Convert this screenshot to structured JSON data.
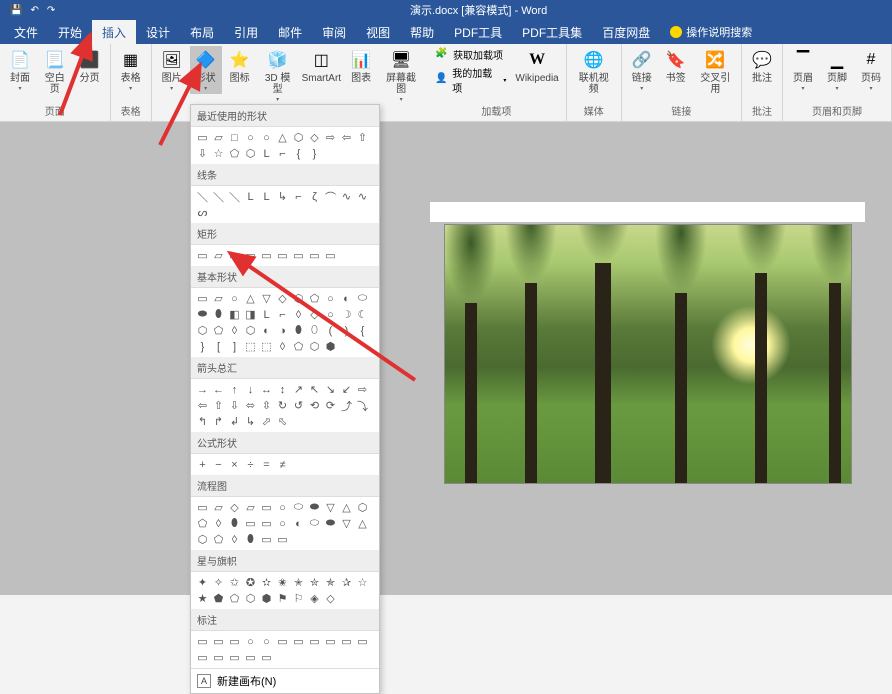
{
  "title": "演示.docx [兼容模式] - Word",
  "tabs": [
    "文件",
    "开始",
    "插入",
    "设计",
    "布局",
    "引用",
    "邮件",
    "审阅",
    "视图",
    "帮助",
    "PDF工具",
    "PDF工具集",
    "百度网盘"
  ],
  "active_tab": 2,
  "tellme": "操作说明搜索",
  "groups": {
    "pages": {
      "label": "页面",
      "items": [
        "封面",
        "空白页",
        "分页"
      ]
    },
    "tables": {
      "label": "表格",
      "items": [
        "表格"
      ]
    },
    "illust": {
      "label": "插图",
      "items": [
        "图片",
        "形状",
        "图标",
        "3D 模型",
        "SmartArt",
        "图表",
        "屏幕截图"
      ]
    },
    "addins": {
      "label": "加载项",
      "get": "获取加载项",
      "my": "我的加载项",
      "wiki": "Wikipedia"
    },
    "media": {
      "label": "媒体",
      "items": [
        "联机视频"
      ]
    },
    "links": {
      "label": "链接",
      "items": [
        "链接",
        "书签",
        "交叉引用"
      ]
    },
    "comments": {
      "label": "批注",
      "items": [
        "批注"
      ]
    },
    "headerfooter": {
      "label": "页眉和页脚",
      "items": [
        "页眉",
        "页脚",
        "页码"
      ]
    }
  },
  "shapes": {
    "sections": [
      {
        "name": "最近使用的形状",
        "shapes": [
          "▭",
          "▱",
          "□",
          "○",
          "○",
          "△",
          "⬡",
          "◇",
          "⇨",
          "⇦",
          "⇧",
          "⇩",
          "☆",
          "⬠",
          "⬡",
          "L",
          "⌐",
          "{",
          "}"
        ]
      },
      {
        "name": "线条",
        "shapes": [
          "＼",
          "＼",
          "＼",
          "L",
          "L",
          "↳",
          "⌐",
          "ζ",
          "⌒",
          "∿",
          "∿",
          "ᔕ"
        ]
      },
      {
        "name": "矩形",
        "shapes": [
          "▭",
          "▱",
          "▭",
          "▭",
          "▭",
          "▭",
          "▭",
          "▭",
          "▭"
        ]
      },
      {
        "name": "基本形状",
        "shapes": [
          "▭",
          "▱",
          "○",
          "△",
          "▽",
          "◇",
          "⬡",
          "⬠",
          "○",
          "◐",
          "⬭",
          "⬬",
          "⬮",
          "◧",
          "◨",
          "L",
          "⌐",
          "◊",
          "◇",
          "○",
          "☽",
          "☾",
          "⬡",
          "⬠",
          "◊",
          "⬡",
          "◐",
          "◑",
          "⬮",
          "⬯",
          "(",
          ")",
          "{",
          "}",
          "[",
          "]",
          "⬚",
          "⬚",
          "◊",
          "⬠",
          "⬡",
          "⬢"
        ]
      },
      {
        "name": "箭头总汇",
        "shapes": [
          "→",
          "←",
          "↑",
          "↓",
          "↔",
          "↕",
          "↗",
          "↖",
          "↘",
          "↙",
          "⇨",
          "⇦",
          "⇧",
          "⇩",
          "⬄",
          "⇳",
          "↻",
          "↺",
          "⟲",
          "⟳",
          "⤴",
          "⤵",
          "↰",
          "↱",
          "↲",
          "↳",
          "⬀",
          "⬁"
        ]
      },
      {
        "name": "公式形状",
        "shapes": [
          "+",
          "−",
          "×",
          "÷",
          "=",
          "≠"
        ]
      },
      {
        "name": "流程图",
        "shapes": [
          "▭",
          "▱",
          "◇",
          "▱",
          "▭",
          "○",
          "⬭",
          "⬬",
          "▽",
          "△",
          "⬡",
          "⬠",
          "◊",
          "⬮",
          "▭",
          "▭",
          "○",
          "◐",
          "⬭",
          "⬬",
          "▽",
          "△",
          "⬡",
          "⬠",
          "◊",
          "⬮",
          "▭",
          "▭"
        ]
      },
      {
        "name": "星与旗帜",
        "shapes": [
          "✦",
          "✧",
          "✩",
          "✪",
          "✫",
          "✬",
          "✭",
          "✮",
          "✯",
          "✰",
          "☆",
          "★",
          "⬟",
          "⬠",
          "⬡",
          "⬢",
          "⚑",
          "⚐",
          "◈",
          "◇"
        ]
      },
      {
        "name": "标注",
        "shapes": [
          "▭",
          "▭",
          "▭",
          "○",
          "○",
          "▭",
          "▭",
          "▭",
          "▭",
          "▭",
          "▭",
          "▭",
          "▭",
          "▭",
          "▭",
          "▭"
        ]
      }
    ],
    "footer": "新建画布(N)"
  }
}
